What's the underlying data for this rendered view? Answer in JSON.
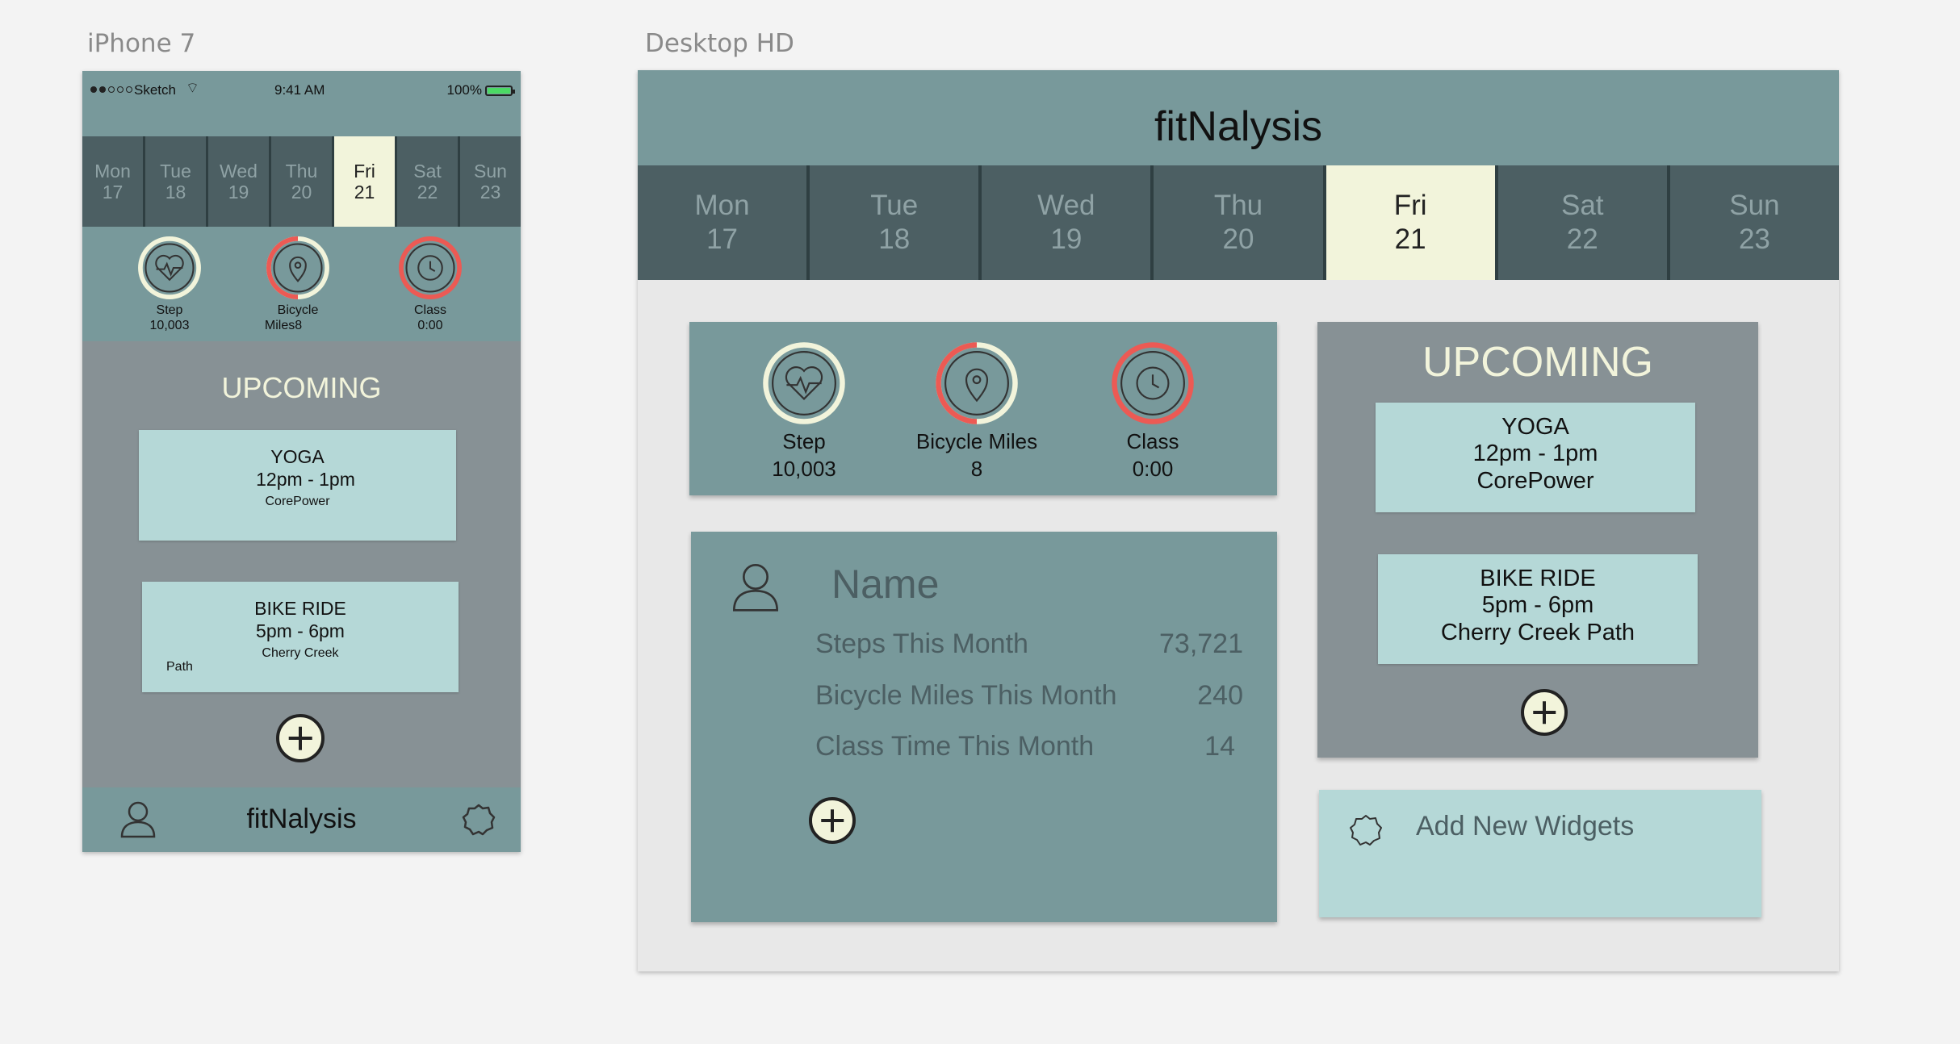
{
  "artboards": {
    "phone_label": "iPhone 7",
    "desktop_label": "Desktop HD"
  },
  "phone": {
    "status": {
      "carrier": "Sketch",
      "time": "9:41 AM",
      "battery": "100%"
    },
    "days": [
      {
        "name": "Mon",
        "num": "17"
      },
      {
        "name": "Tue",
        "num": "18"
      },
      {
        "name": "Wed",
        "num": "19"
      },
      {
        "name": "Thu",
        "num": "20"
      },
      {
        "name": "Fri",
        "num": "21"
      },
      {
        "name": "Sat",
        "num": "22"
      },
      {
        "name": "Sun",
        "num": "23"
      }
    ],
    "metrics": [
      {
        "label": "Step",
        "value": "10,003"
      },
      {
        "label": "Bicycle",
        "value": "Miles",
        "value2": "8"
      },
      {
        "label": "Class",
        "value": "0:00"
      }
    ],
    "upcoming_title": "UPCOMING",
    "events": [
      {
        "title": "YOGA",
        "time": "12pm - 1pm",
        "place": "CorePower"
      },
      {
        "title": "BIKE RIDE",
        "time": "5pm - 6pm",
        "place": "Cherry Creek",
        "place2": "Path"
      }
    ],
    "brand": "fitNalysis"
  },
  "desktop": {
    "brand": "fitNalysis",
    "days": [
      {
        "name": "Mon",
        "num": "17"
      },
      {
        "name": "Tue",
        "num": "18"
      },
      {
        "name": "Wed",
        "num": "19"
      },
      {
        "name": "Thu",
        "num": "20"
      },
      {
        "name": "Fri",
        "num": "21"
      },
      {
        "name": "Sat",
        "num": "22"
      },
      {
        "name": "Sun",
        "num": "23"
      }
    ],
    "metrics": [
      {
        "label": "Step",
        "value": "10,003"
      },
      {
        "label": "Bicycle Miles",
        "value": "8"
      },
      {
        "label": "Class",
        "value": "0:00"
      }
    ],
    "profile": {
      "name": "Name",
      "stats": [
        {
          "label": "Steps This Month",
          "value": "73,721"
        },
        {
          "label": "Bicycle Miles This Month",
          "value": "240"
        },
        {
          "label": "Class Time This Month",
          "value": "14"
        }
      ]
    },
    "upcoming_title": "UPCOMING",
    "events": [
      {
        "title": "YOGA",
        "time": "12pm - 1pm",
        "place": "CorePower"
      },
      {
        "title": "BIKE RIDE",
        "time": "5pm - 6pm",
        "place": "Cherry Creek Path"
      }
    ],
    "add_widgets": "Add New Widgets"
  },
  "colors": {
    "accent_teal": "#78999b",
    "day_bar": "#4c5f63",
    "selected_day": "#f2f4db",
    "card": "#b5d8d7",
    "ring_red": "#ec5a54"
  },
  "icons": [
    "heart-rate-icon",
    "location-pin-icon",
    "clock-icon",
    "user-icon",
    "gear-icon",
    "plus-icon"
  ]
}
